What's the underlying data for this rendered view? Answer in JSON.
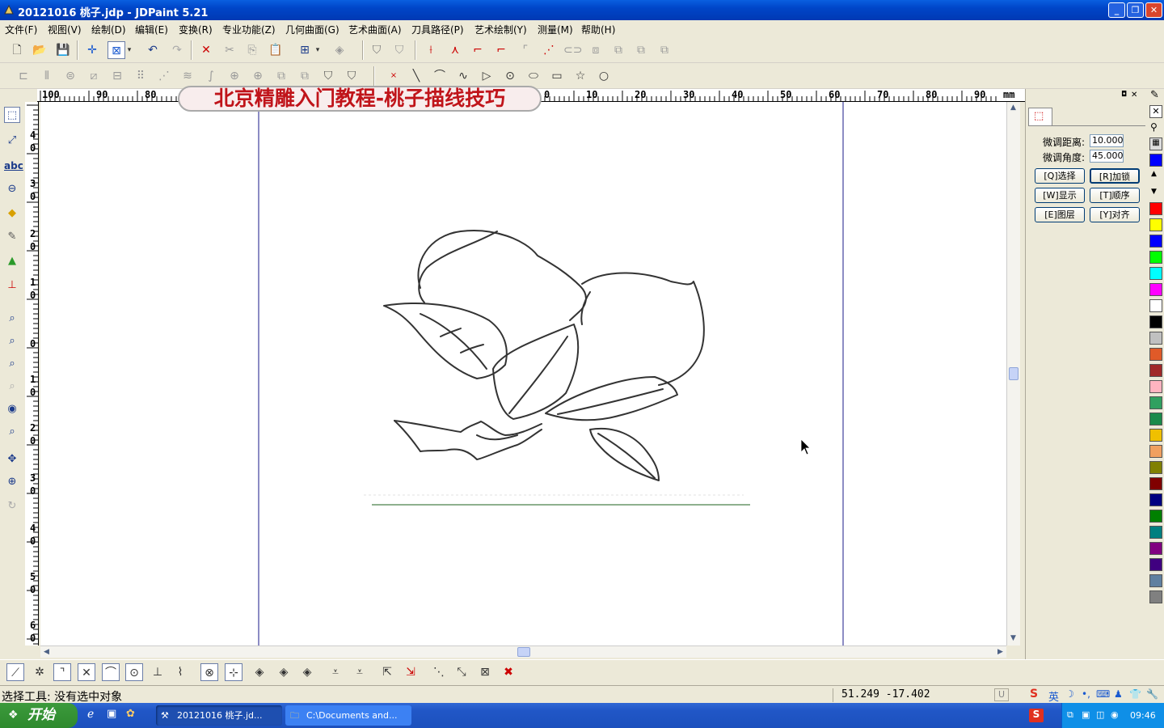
{
  "window": {
    "title": "20121016 桃子.jdp - JDPaint 5.21"
  },
  "menu": [
    "文件(F)",
    "视图(V)",
    "绘制(D)",
    "编辑(E)",
    "变换(R)",
    "专业功能(Z)",
    "几何曲面(G)",
    "艺术曲面(A)",
    "刀具路径(P)",
    "艺术绘制(Y)",
    "测量(M)",
    "帮助(H)"
  ],
  "banner": {
    "text": "北京精雕入门教程-桃子描线技巧"
  },
  "ruler": {
    "h_labels": [
      "100",
      "90",
      "80",
      "0",
      "10",
      "20",
      "30",
      "40",
      "50",
      "60",
      "70",
      "80",
      "90",
      "mm"
    ],
    "v_labels": [
      "4",
      "0",
      "3",
      "0",
      "2",
      "0",
      "1",
      "0",
      "0",
      "1",
      "0",
      "2",
      "0",
      "3",
      "0",
      "4",
      "0",
      "5",
      "0",
      "6",
      "0"
    ]
  },
  "panel": {
    "nudge_distance_label": "微调距离:",
    "nudge_distance_value": "10.000",
    "nudge_angle_label": "微调角度:",
    "nudge_angle_value": "45.000",
    "buttons": {
      "select": "[Q]选择",
      "lock": "[R]加锁",
      "show": "[W]显示",
      "order": "[T]顺序",
      "layer": "[E]图层",
      "align": "[Y]对齐"
    }
  },
  "palette": [
    "#ff0000",
    "#ffff00",
    "#0000ff",
    "#00ff00",
    "#00ffff",
    "#ff00ff",
    "#ffffff",
    "#000000",
    "#c0c0c0",
    "#e05a28",
    "#a02828",
    "#ffb4c0",
    "#30a060",
    "#1a8a4a",
    "#f0c000",
    "#f0a060",
    "#808000",
    "#800000",
    "#000080",
    "#008000",
    "#008080",
    "#800080",
    "#400080",
    "#6080a0",
    "#808080"
  ],
  "status": {
    "text": "选择工具: 没有选中对象",
    "coords": "51.249 -17.402",
    "mode": "U"
  },
  "taskbar": {
    "start": "开始",
    "tasks": [
      "20121016 桃子.jd...",
      "C:\\Documents and..."
    ],
    "tray_lang": "英",
    "time": "09:46"
  }
}
